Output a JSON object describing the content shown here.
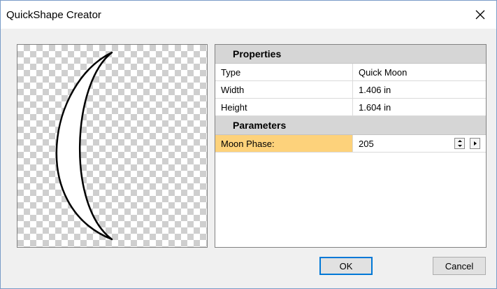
{
  "window": {
    "title": "QuickShape Creator",
    "close_glyph": "✕"
  },
  "properties": {
    "section_label": "Properties",
    "rows": [
      {
        "label": "Type",
        "value": "Quick Moon"
      },
      {
        "label": "Width",
        "value": "1.406 in"
      },
      {
        "label": "Height",
        "value": "1.604 in"
      }
    ]
  },
  "parameters": {
    "section_label": "Parameters",
    "rows": [
      {
        "label": "Moon Phase:",
        "value": "205"
      }
    ]
  },
  "buttons": {
    "ok": "OK",
    "cancel": "Cancel"
  },
  "colors": {
    "selected_row": "#fdd27b",
    "section_header": "#d6d6d6",
    "default_button_border": "#0078d7"
  },
  "icons": {
    "close": "close-icon",
    "spin": "spin-up-down-icon",
    "expand": "right-arrow-icon"
  }
}
